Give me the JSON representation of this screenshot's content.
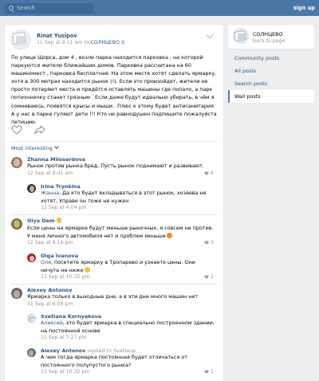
{
  "header": {
    "search_placeholder": "Search",
    "signup_label": "sign up"
  },
  "post": {
    "author": "Rinat Yusipov",
    "date": "11 Sep at 9:11 am",
    "to_word": "to",
    "group": "СОЛНЦЕВО",
    "text": "По улице Щорса, дом 4 , возле парка находится парковка , на которой паркуются жители ближайших домов. Парковка рассчитана на 60 машиномест , парковка бесплатная. На этом месте хотят сделать ярмарку, хотя в 300 метрах находится рынок (!). Если это произойдет, жители не просто потеряют места и придётся оставлять машины где попало, а парк потихонечку станет грязным . Если даже будут идеально убирать, в чём я сомневаюсь, появятся крысы и мыши . Плюс к этому будет антисанитария. А у нас в парке гуляют дети !!! Кто не равнодушен подпишите пожалуйста петицию."
  },
  "comments_header": "Most interesting",
  "comments": [
    {
      "name": "Zhanna Miloserdova",
      "text": "Рынок против рынка бред. Пусть рынок поднимают и развивают.",
      "date": "12 Sep at 9:41 am",
      "likes": "6"
    },
    {
      "name": "Irina Trynkina",
      "addressee": "Жанна",
      "text": ", Да кто будет вкладываться в этот рынок, хозяева не хотят, Управе он тоже не нужен",
      "date": "12 Sep at 4:04 pm",
      "likes": ""
    },
    {
      "name": "Olya Dem",
      "text": "Если цены на ярмарке будут меньше рыночных, я совсем не против. У меня личного автомобиля нет и проблем меньше",
      "date": "12 Sep at 8:16 pm",
      "likes": "3"
    },
    {
      "name": "Olga Ivanova",
      "addressee": "Оля",
      "text": ", посетите ярмарку в Тропарево и узнаете цены. Они ничуть не ниже",
      "date": "11 Sep at 10:35 pm",
      "likes": "2"
    },
    {
      "name": "Alexey Antonov",
      "text": "Ярмарка только в выходные дни, а в эти дни много машин нет",
      "date": "11 Sep at 6:08 pm",
      "likes": ""
    },
    {
      "name": "Svetlana Kornyakova",
      "addressee": "Алексей",
      "text": ", это будет ярмарка в специально построенном здании, на постоянной основе",
      "date": "11 Sep at 7:27 pm",
      "likes": ""
    },
    {
      "name": "Alexey Antonov",
      "reply_to": "replied to Svetlana",
      "text": "А чем тогда ярмарка постоянная будет отличаться от постоянного полупустого рынка?",
      "date": "11 Sep at 10:32 pm",
      "likes": "1"
    }
  ],
  "sidebar": {
    "group_name": "СОЛНЦЕВО",
    "back_label": "back to page",
    "menu": [
      {
        "label": "Community posts",
        "active": false
      },
      {
        "label": "All posts",
        "active": false
      },
      {
        "label": "Search posts",
        "active": false
      },
      {
        "label": "Wall posts",
        "active": true
      }
    ]
  },
  "colors": {
    "header_bg": "#4a76a8",
    "link": "#2a5885",
    "muted": "#939393",
    "page_bg": "#edeef0"
  }
}
